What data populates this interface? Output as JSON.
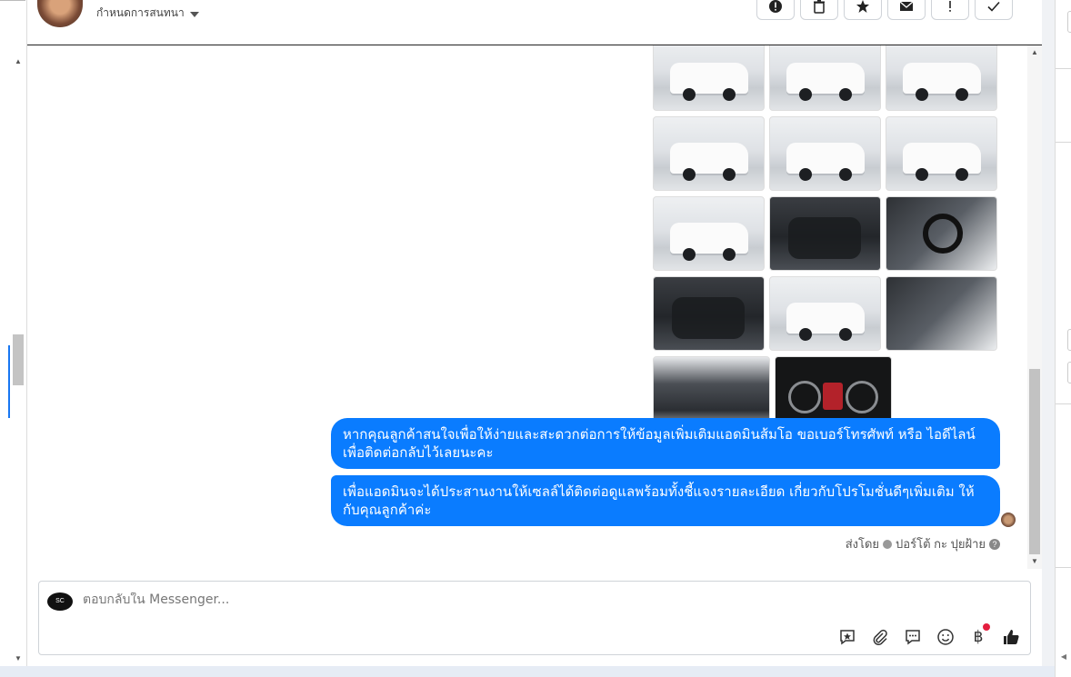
{
  "header": {
    "assign_label": "กำหนดการสนทนา",
    "toolbar_icons": [
      "alert-circle-icon",
      "trash-icon",
      "star-icon",
      "mail-icon",
      "exclamation-icon",
      "check-icon"
    ]
  },
  "gallery": {
    "rows": [
      [
        "car-front-exterior",
        "car-front-exterior",
        "car-front-exterior"
      ],
      [
        "car-rear-exterior",
        "car-rear-three-quarter",
        "car-side-exterior"
      ],
      [
        "car-side-exterior",
        "car-interior-dashboard",
        "car-steering-wheel"
      ],
      [
        "car-rear-seats",
        "car-front-wheel",
        "car-door-panel"
      ],
      [
        "car-engine-bay",
        "car-instrument-cluster"
      ]
    ]
  },
  "messages": [
    {
      "text": "หากคุณลูกค้าสนใจเพื่อให้ง่ายและสะดวกต่อการให้ข้อมูลเพิ่มเติมแอดมินส้มโอ ขอเบอร์โทรศัพท์ หรือ ไอดีไลน์ เพื่อติดต่อกลับไว้เลยนะคะ"
    },
    {
      "text": "เพื่อแอดมินจะได้ประสานงานให้เซลล์ได้ติดต่อดูแลพร้อมทั้งชี้แจงรายละเอียด เกี่ยวกับโปรโมชั่นดีๆเพิ่มเติม ให้กับคุณลูกค้าค่ะ"
    }
  ],
  "sent_by": {
    "prefix": "ส่งโดย",
    "name": "ปอร์โต้ กะ ปุยฝ้าย"
  },
  "composer": {
    "placeholder": "ตอบกลับใน Messenger...",
    "icons": [
      "saved-reply-icon",
      "attachment-icon",
      "chat-bubble-icon",
      "emoji-icon",
      "baht-icon",
      "thumbs-up-icon"
    ]
  },
  "colors": {
    "bubble": "#0a7cff",
    "accent": "#1877f2",
    "notification": "#e41e3f"
  }
}
